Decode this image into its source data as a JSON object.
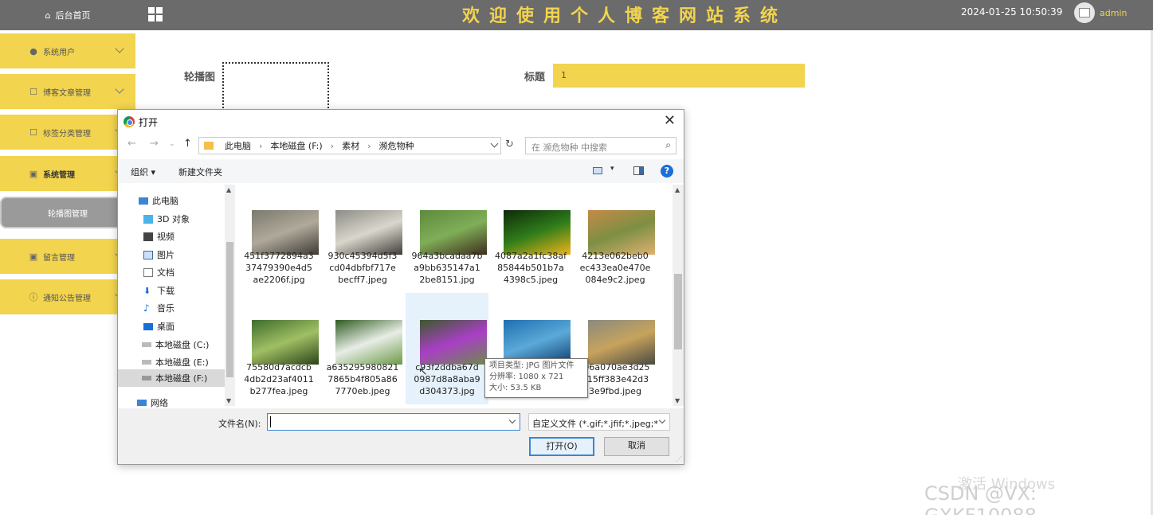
{
  "sidebar": {
    "home_label": "后台首页",
    "items": [
      {
        "label": "系统用户",
        "icon": "user-icon"
      },
      {
        "label": "博客文章管理",
        "icon": "edit-icon"
      },
      {
        "label": "标签分类管理",
        "icon": "edit-icon"
      },
      {
        "label": "系统管理",
        "icon": "picture-icon"
      },
      {
        "label": "留言管理",
        "icon": "picture-icon"
      },
      {
        "label": "通知公告管理",
        "icon": "info-icon"
      }
    ],
    "sub_item": "轮播图管理"
  },
  "header": {
    "title": "欢迎使用个人博客网站系统",
    "datetime": "2024-01-25 10:50:39",
    "user": "admin"
  },
  "form": {
    "carousel_label": "轮播图",
    "title_label": "标题",
    "title_value": "1"
  },
  "dialog": {
    "title": "打开",
    "breadcrumb": [
      "此电脑",
      "本地磁盘 (F:)",
      "素材",
      "濒危物种"
    ],
    "search_placeholder": "在 濒危物种 中搜索",
    "organize": "组织 ▾",
    "new_folder": "新建文件夹",
    "tree": [
      "此电脑",
      "3D 对象",
      "视频",
      "图片",
      "文档",
      "下载",
      "音乐",
      "桌面",
      "本地磁盘 (C:)",
      "本地磁盘 (E:)",
      "本地磁盘 (F:)",
      "网络"
    ],
    "files": [
      {
        "name": "451f3772894a337479390e4d5ae2206f.jpg",
        "colors": [
          "#7a7a6e",
          "#b0a99a",
          "#3d3a34"
        ]
      },
      {
        "name": "930c45394d5f3cd04dbfbf717ebecff7.jpeg",
        "colors": [
          "#8c8c86",
          "#d9d6cc",
          "#3f3d38"
        ]
      },
      {
        "name": "964a3bcadaa7ba9bb635147a12be8151.jpg",
        "colors": [
          "#5d8a3c",
          "#7fae58",
          "#3e2d1c"
        ]
      },
      {
        "name": "4087a2a1fc38af85844b501b7a4398c5.jpeg",
        "colors": [
          "#0e2a0a",
          "#2f7d1a",
          "#f0b31b"
        ]
      },
      {
        "name": "4213e062beb0ec433ea0e470e084e9c2.jpeg",
        "colors": [
          "#c58a46",
          "#7d8f44",
          "#e0b070"
        ]
      },
      {
        "name": "75580d7acdcb4db2d23af4011b277fea.jpeg",
        "colors": [
          "#3e6d2b",
          "#a0bf64",
          "#2a4418"
        ]
      },
      {
        "name": "a6352959808217865b4f805a867770eb.jpeg",
        "colors": [
          "#2f5c22",
          "#e8ede6",
          "#6c9a48"
        ]
      },
      {
        "name": "c93f2ddba67d0987d8a8aba9d304373.jpg",
        "colors": [
          "#3b5a2a",
          "#a93fc6",
          "#6d8a4c"
        ]
      },
      {
        "name": "891b5db4.jpeg",
        "colors": [
          "#1f6fb0",
          "#5ba9d8",
          "#0e3c6e"
        ]
      },
      {
        "name": "f06a070ae3d25015ff383e42d33e9fbd.jpeg",
        "colors": [
          "#8a8a80",
          "#c7a35c",
          "#4a4a44"
        ]
      }
    ],
    "file_name_lines": [
      [
        "451f3772894a3",
        "37479390e4d5",
        "ae2206f.jpg"
      ],
      [
        "930c45394d5f3",
        "cd04dbfbf717e",
        "becff7.jpeg"
      ],
      [
        "964a3bcadaa7b",
        "a9bb635147a1",
        "2be8151.jpg"
      ],
      [
        "4087a2a1fc38af",
        "85844b501b7a",
        "4398c5.jpeg"
      ],
      [
        "4213e062beb0",
        "ec433ea0e470e",
        "084e9c2.jpeg"
      ],
      [
        "75580d7acdcb",
        "4db2d23af4011",
        "b277fea.jpeg"
      ],
      [
        "a635295980821",
        "7865b4f805a86",
        "7770eb.jpeg"
      ],
      [
        "c93f2ddba67d",
        "0987d8a8aba9",
        "d304373.jpg"
      ],
      [
        "",
        "",
        "891b5db4.jpeg"
      ],
      [
        "f06a070ae3d25",
        "015ff383e42d3",
        "3e9fbd.jpeg"
      ]
    ],
    "tooltip": [
      "项目类型: JPG 图片文件",
      "分辨率: 1080 x 721",
      "大小: 53.5 KB"
    ],
    "filename_label": "文件名(N):",
    "filename_value": "",
    "filter": "自定义文件 (*.gif;*.jfif;*.jpeg;*",
    "open_button": "打开(O)",
    "cancel_button": "取消"
  },
  "watermark": {
    "activate": "激活 Windows",
    "csdn": "CSDN @VX: GXKF10088"
  }
}
